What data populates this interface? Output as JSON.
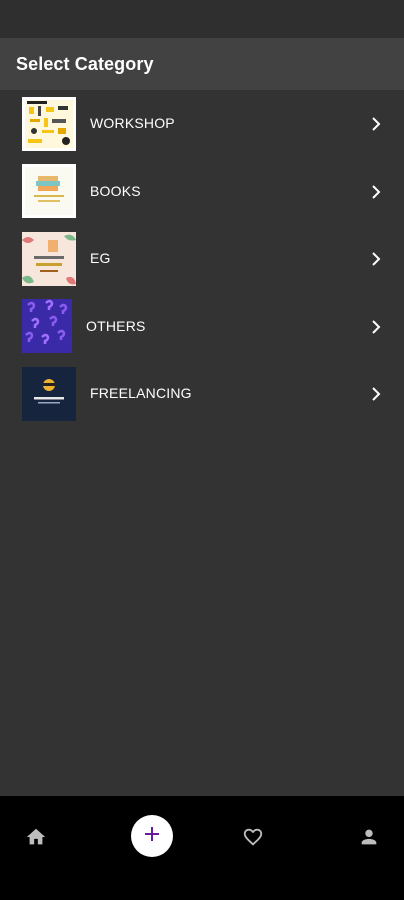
{
  "app_bar": {
    "title": "Select Category"
  },
  "categories": [
    {
      "label": "WORKSHOP",
      "thumb_icon": "workshop-thumbnail"
    },
    {
      "label": "BOOKS",
      "thumb_icon": "books-thumbnail"
    },
    {
      "label": "EG",
      "thumb_icon": "engineering-graphics-thumbnail"
    },
    {
      "label": "OTHERS",
      "thumb_icon": "others-thumbnail"
    },
    {
      "label": "FREELANCING",
      "thumb_icon": "freelancing-thumbnail"
    }
  ],
  "bottom_nav": {
    "items": [
      {
        "icon": "home-icon"
      },
      {
        "icon": "plus-icon"
      },
      {
        "icon": "heart-icon"
      },
      {
        "icon": "person-icon"
      }
    ]
  },
  "colors": {
    "background": "#333333",
    "app_bar": "#424242",
    "status_bar": "#2f2f2f",
    "bottom_nav": "#000000",
    "accent": "#6a1b9a",
    "text": "#ffffff"
  }
}
